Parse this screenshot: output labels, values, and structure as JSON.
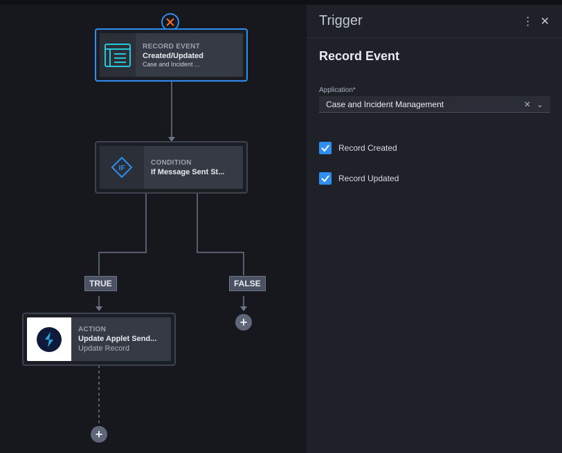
{
  "canvas": {
    "trigger_node": {
      "kind": "RECORD EVENT",
      "title": "Created/Updated",
      "subtitle": "Case and Incident ..."
    },
    "condition_node": {
      "kind": "CONDITION",
      "title": "If Message Sent St...",
      "icon_text": "IF"
    },
    "branch_true": "TRUE",
    "branch_false": "FALSE",
    "action_node": {
      "kind": "ACTION",
      "title": "Update Applet Send...",
      "subtitle": "Update Record"
    },
    "plus_symbol": "+"
  },
  "panel": {
    "title": "Trigger",
    "section_title": "Record Event",
    "application_label": "Application*",
    "application_value": "Case and Incident Management",
    "checkboxes": [
      {
        "label": "Record Created",
        "checked": true
      },
      {
        "label": "Record Updated",
        "checked": true
      }
    ]
  },
  "colors": {
    "accent": "#2f8ef2",
    "delete_orange": "#f26b2f",
    "teal": "#27c8d9"
  },
  "icons": [
    "close-circle-icon",
    "record-event-icon",
    "condition-if-icon",
    "applet-logo-icon",
    "kebab-menu-icon",
    "close-icon",
    "clear-icon",
    "chevron-down-icon",
    "checkmark-icon"
  ]
}
